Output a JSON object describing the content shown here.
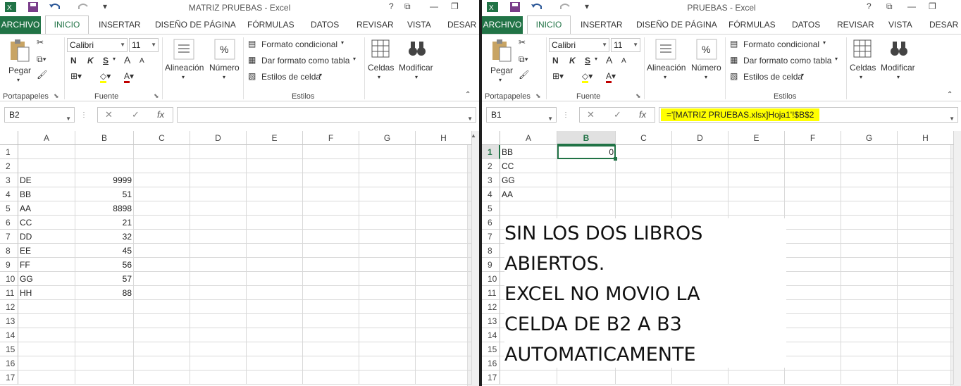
{
  "left": {
    "title": "MATRIZ PRUEBAS - Excel",
    "tabs": [
      "ARCHIVO",
      "INICIO",
      "INSERTAR",
      "DISEÑO DE PÁGINA",
      "FÓRMULAS",
      "DATOS",
      "REVISAR",
      "VISTA",
      "DESAR"
    ],
    "ribbon": {
      "pegar": "Pegar",
      "font_name": "Calibri",
      "font_size": "11",
      "bold": "N",
      "italic": "K",
      "underline": "S",
      "alineacion": "Alineación",
      "numero": "Número",
      "formato_condicional": "Formato condicional",
      "dar_formato": "Dar formato como tabla",
      "estilos_celda": "Estilos de celda",
      "celdas": "Celdas",
      "modificar": "Modificar",
      "groups": {
        "portapapeles": "Portapapeles",
        "fuente": "Fuente",
        "estilos": "Estilos"
      }
    },
    "name_box": "B2",
    "formula": "",
    "columns": [
      "A",
      "B",
      "C",
      "D",
      "E",
      "F",
      "G",
      "H"
    ],
    "rows": [
      {
        "n": "1",
        "a": "",
        "b": ""
      },
      {
        "n": "2",
        "a": "",
        "b": ""
      },
      {
        "n": "3",
        "a": "DE",
        "b": "9999"
      },
      {
        "n": "4",
        "a": "BB",
        "b": "51"
      },
      {
        "n": "5",
        "a": "AA",
        "b": "8898"
      },
      {
        "n": "6",
        "a": "CC",
        "b": "21"
      },
      {
        "n": "7",
        "a": "DD",
        "b": "32"
      },
      {
        "n": "8",
        "a": "EE",
        "b": "45"
      },
      {
        "n": "9",
        "a": "FF",
        "b": "56"
      },
      {
        "n": "10",
        "a": "GG",
        "b": "57"
      },
      {
        "n": "11",
        "a": "HH",
        "b": "88"
      },
      {
        "n": "12",
        "a": "",
        "b": ""
      },
      {
        "n": "13",
        "a": "",
        "b": ""
      },
      {
        "n": "14",
        "a": "",
        "b": ""
      },
      {
        "n": "15",
        "a": "",
        "b": ""
      },
      {
        "n": "16",
        "a": "",
        "b": ""
      },
      {
        "n": "17",
        "a": "",
        "b": ""
      }
    ]
  },
  "right": {
    "title": "PRUEBAS - Excel",
    "tabs": [
      "ARCHIVO",
      "INICIO",
      "INSERTAR",
      "DISEÑO DE PÁGINA",
      "FÓRMULAS",
      "DATOS",
      "REVISAR",
      "VISTA",
      "DESAR"
    ],
    "ribbon": {
      "pegar": "Pegar",
      "font_name": "Calibri",
      "font_size": "11",
      "bold": "N",
      "italic": "K",
      "underline": "S",
      "alineacion": "Alineación",
      "numero": "Número",
      "formato_condicional": "Formato condicional",
      "dar_formato": "Dar formato como tabla",
      "estilos_celda": "Estilos de celda",
      "celdas": "Celdas",
      "modificar": "Modificar",
      "groups": {
        "portapapeles": "Portapapeles",
        "fuente": "Fuente",
        "estilos": "Estilos"
      }
    },
    "name_box": "B1",
    "formula": "='[MATRIZ PRUEBAS.xlsx]Hoja1'!$B$2",
    "formula_highlight": "#ffff00",
    "columns": [
      "A",
      "B",
      "C",
      "D",
      "E",
      "F",
      "G",
      "H"
    ],
    "rows": [
      {
        "n": "1",
        "a": "BB",
        "b": "0"
      },
      {
        "n": "2",
        "a": "CC",
        "b": ""
      },
      {
        "n": "3",
        "a": "GG",
        "b": ""
      },
      {
        "n": "4",
        "a": "AA",
        "b": ""
      },
      {
        "n": "5",
        "a": "",
        "b": ""
      },
      {
        "n": "6",
        "a": "",
        "b": ""
      },
      {
        "n": "7",
        "a": "",
        "b": ""
      },
      {
        "n": "8",
        "a": "",
        "b": ""
      },
      {
        "n": "9",
        "a": "",
        "b": ""
      },
      {
        "n": "10",
        "a": "",
        "b": ""
      },
      {
        "n": "11",
        "a": "",
        "b": ""
      },
      {
        "n": "12",
        "a": "",
        "b": ""
      },
      {
        "n": "13",
        "a": "",
        "b": ""
      },
      {
        "n": "14",
        "a": "",
        "b": ""
      },
      {
        "n": "15",
        "a": "",
        "b": ""
      },
      {
        "n": "16",
        "a": "",
        "b": ""
      },
      {
        "n": "17",
        "a": "",
        "b": ""
      }
    ],
    "note": [
      "SIN LOS DOS LIBROS",
      "ABIERTOS.",
      "EXCEL NO MOVIO LA",
      "CELDA DE B2 A B3",
      "AUTOMATICAMENTE"
    ]
  },
  "colors": {
    "excel_green": "#217346",
    "highlight": "#ffff00"
  }
}
